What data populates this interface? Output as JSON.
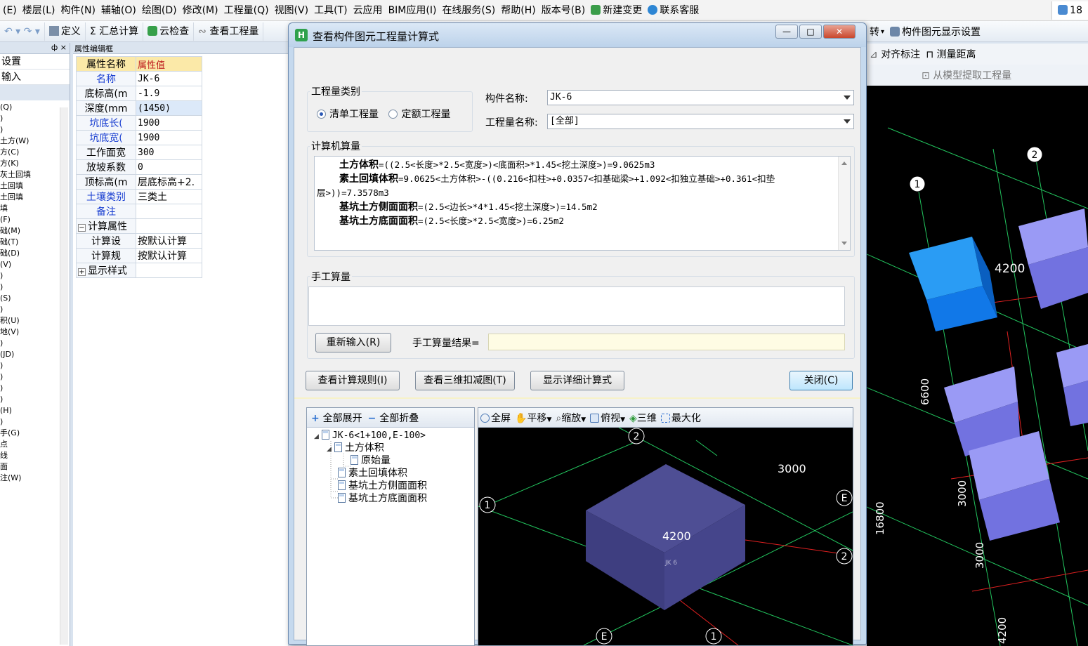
{
  "menubar": {
    "items": [
      "(E)",
      "楼层(L)",
      "构件(N)",
      "辅轴(O)",
      "绘图(D)",
      "修改(M)",
      "工程量(Q)",
      "视图(V)",
      "工具(T)",
      "云应用",
      "BIM应用(I)",
      "在线服务(S)",
      "帮助(H)",
      "版本号(B)",
      "新建变更",
      "联系客服"
    ],
    "right_text": "18"
  },
  "toolbar": {
    "items": [
      "定义",
      "汇总计算",
      "云检查",
      "查看工程量"
    ]
  },
  "right_toolbar": {
    "row1": [
      "转",
      "构件图元显示设置"
    ],
    "row2": [
      "对齐标注",
      "测量距离"
    ],
    "row3": [
      "从模型提取工程量"
    ]
  },
  "left_panel": {
    "header": "ф ×",
    "rows": [
      "设置",
      "输入"
    ],
    "items": [
      "(Q)",
      ")",
      ")",
      "土方(W)",
      "方(C)",
      "方(K)",
      "灰土回填",
      "土回填",
      "土回填",
      "填",
      "(F)",
      "础(M)",
      "础(T)",
      "础(D)",
      "(V)",
      ")",
      ")",
      "(S)",
      ")",
      "积(U)",
      "地(V)",
      ")",
      "(JD)",
      ")",
      ")",
      ")",
      ")",
      "(H)",
      ")",
      "手(G)",
      "点",
      "线",
      "面",
      "注(W)"
    ]
  },
  "property_panel": {
    "title": "属性编辑框",
    "head": {
      "name": "属性名称",
      "value": "属性值"
    },
    "rows": [
      {
        "name": "名称",
        "value": "JK-6",
        "blue": true
      },
      {
        "name": "底标高(m",
        "value": "-1.9",
        "blue": false
      },
      {
        "name": "深度(mm",
        "value": "(1450)",
        "blue": false
      },
      {
        "name": "坑底长(",
        "value": "1900",
        "blue": true
      },
      {
        "name": "坑底宽(",
        "value": "1900",
        "blue": true
      },
      {
        "name": "工作面宽",
        "value": "300",
        "blue": false
      },
      {
        "name": "放坡系数",
        "value": "0",
        "blue": false
      },
      {
        "name": "顶标高(m",
        "value": "层底标高+2.",
        "blue": false
      },
      {
        "name": "土壤类别",
        "value": "三类土",
        "blue": true
      },
      {
        "name": "备注",
        "value": "",
        "blue": true
      }
    ],
    "group1": {
      "label": "计算属性",
      "toggle": "−"
    },
    "group1_rows": [
      {
        "name": "计算设",
        "value": "按默认计算"
      },
      {
        "name": "计算规",
        "value": "按默认计算"
      }
    ],
    "group2": {
      "label": "显示样式",
      "toggle": "+"
    }
  },
  "dialog": {
    "title": "查看构件图元工程量计算式",
    "window_buttons": {
      "minimize": "—",
      "maximize": "□",
      "close": "✕"
    },
    "quantity_type": {
      "label": "工程量类别",
      "options": [
        {
          "label": "清单工程量",
          "selected": true
        },
        {
          "label": "定额工程量",
          "selected": false
        }
      ]
    },
    "component_name": {
      "label": "构件名称:",
      "value": "JK-6"
    },
    "quantity_name": {
      "label": "工程量名称:",
      "value": "[全部]"
    },
    "computer_calc": {
      "label": "计算机算量",
      "lines": [
        {
          "bold": "土方体积",
          "rest": "=((2.5<长度>*2.5<宽度>)<底面积>*1.45<挖土深度>)=9.0625m3"
        },
        {
          "bold": "素土回填体积",
          "rest": "=9.0625<土方体积>-((0.216<扣柱>+0.0357<扣基础梁>+1.092<扣独立基础>+0.361<扣垫"
        },
        {
          "bold": "",
          "rest": "层>))=7.3578m3"
        },
        {
          "bold": "基坑土方侧面面积",
          "rest": "=(2.5<边长>*4*1.45<挖土深度>)=14.5m2"
        },
        {
          "bold": "基坑土方底面面积",
          "rest": "=(2.5<长度>*2.5<宽度>)=6.25m2"
        }
      ]
    },
    "manual_calc": {
      "label": "手工算量",
      "value": "",
      "reenter_button": "重新输入(R)",
      "result_label": "手工算量结果=",
      "result_value": ""
    },
    "buttons": {
      "view_rules": "查看计算规则(I)",
      "view_3d": "查看三维扣减图(T)",
      "show_detail": "显示详细计算式",
      "close": "关闭(C)"
    },
    "tree": {
      "expand_all": "全部展开",
      "collapse_all": "全部折叠",
      "nodes": [
        {
          "label": "JK-6<1+100,E-100>",
          "toggle": "◢"
        },
        {
          "label": "土方体积",
          "toggle": "◢"
        },
        {
          "label": "原始量",
          "toggle": ""
        },
        {
          "label": "素土回填体积",
          "toggle": ""
        },
        {
          "label": "基坑土方侧面面积",
          "toggle": ""
        },
        {
          "label": "基坑土方底面面积",
          "toggle": ""
        }
      ]
    },
    "viewer": {
      "toolbar": [
        "全屏",
        "平移",
        "缩放",
        "俯视",
        "三维",
        "最大化"
      ],
      "labels": {
        "axis_2": "2",
        "axis_1_left": "1",
        "axis_E_right": "E",
        "axis_2_right": "2",
        "axis_E_bottom": "E",
        "axis_1_bottom": "1",
        "dim_3000": "3000",
        "dim_4200": "4200",
        "box_label": "JK 6"
      }
    }
  },
  "main_view": {
    "labels": {
      "axis_2": "2",
      "axis_1": "1",
      "dim_4200_top": "4200",
      "dim_6600": "6600",
      "dim_3000_a": "3000",
      "dim_16800": "16800",
      "dim_3000_b": "3000",
      "dim_4200_bottom": "4200"
    }
  },
  "colors": {
    "accent_blue": "#1a3fd1",
    "grid_green": "#22c55e",
    "grid_red": "#e02020",
    "box_purple": "#4b4b8f",
    "box_light": "#8a8aef",
    "box_selected": "#1178e8"
  }
}
